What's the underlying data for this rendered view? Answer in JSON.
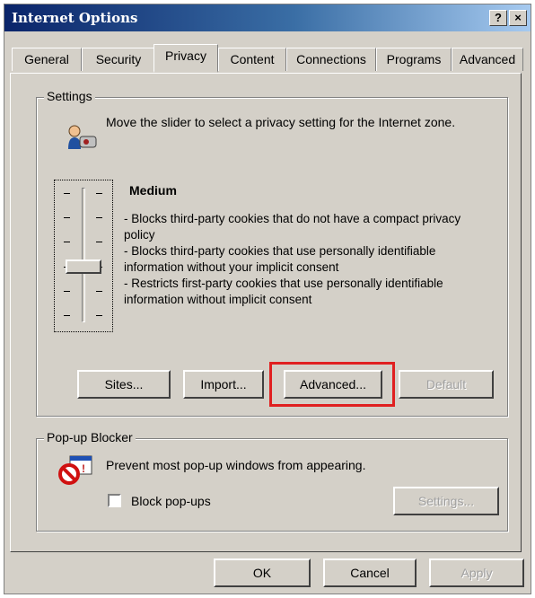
{
  "window": {
    "title": "Internet Options",
    "help_btn": "?",
    "close_btn": "×"
  },
  "tabs": [
    {
      "label": "General"
    },
    {
      "label": "Security"
    },
    {
      "label": "Privacy",
      "active": true
    },
    {
      "label": "Content"
    },
    {
      "label": "Connections"
    },
    {
      "label": "Programs"
    },
    {
      "label": "Advanced"
    }
  ],
  "settings": {
    "legend": "Settings",
    "instruction": "Move the slider to select a privacy setting for the Internet zone.",
    "level": "Medium",
    "bullets": [
      "- Blocks third-party cookies that do not have a compact privacy policy",
      "- Blocks third-party cookies that use personally identifiable information without your implicit consent",
      "- Restricts first-party cookies that use personally identifiable information without implicit consent"
    ],
    "slider_level": 3,
    "slider_steps": 6,
    "buttons": {
      "sites": "Sites...",
      "import": "Import...",
      "advanced": "Advanced...",
      "default": "Default"
    }
  },
  "popup_blocker": {
    "legend": "Pop-up Blocker",
    "description": "Prevent most pop-up windows from appearing.",
    "checkbox_label": "Block pop-ups",
    "checkbox_checked": false,
    "settings_button": "Settings..."
  },
  "footer": {
    "ok": "OK",
    "cancel": "Cancel",
    "apply": "Apply"
  },
  "colors": {
    "highlight": "#e02020",
    "title_start": "#0a246a",
    "title_end": "#a6caf0"
  },
  "icons": {
    "privacy": "privacy-user-icon",
    "popup": "popup-blocker-icon"
  }
}
